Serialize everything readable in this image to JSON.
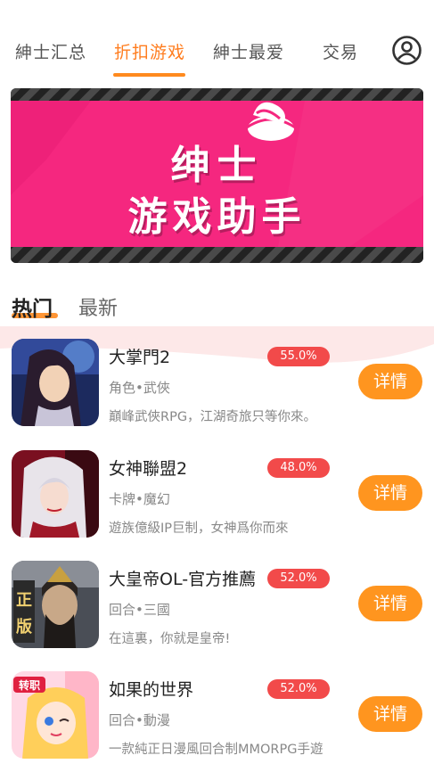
{
  "nav": {
    "tabs": [
      "紳士汇总",
      "折扣游戏",
      "紳士最爱",
      "交易"
    ],
    "active_index": 1
  },
  "banner": {
    "line1": "绅士",
    "line2": "游戏助手"
  },
  "sections": {
    "hot": "热门",
    "new": "最新"
  },
  "games": [
    {
      "name": "大掌門2",
      "discount": "55.0%",
      "category": "角色•武俠",
      "desc": "巔峰武俠RPG，江湖奇旅只等你來。",
      "button": "详情"
    },
    {
      "name": "女神聯盟2",
      "discount": "48.0%",
      "category": "卡牌•魔幻",
      "desc": "遊族億級IP巨制，女神爲你而來",
      "button": "详情"
    },
    {
      "name": "大皇帝OL-官方推薦",
      "discount": "52.0%",
      "category": "回合•三國",
      "desc": "在這裏，你就是皇帝!",
      "button": "详情"
    },
    {
      "name": "如果的世界",
      "discount": "52.0%",
      "category": "回合•動漫",
      "desc": "一款純正日漫風回合制MMORPG手遊",
      "button": "详情"
    }
  ],
  "colors": {
    "accent": "#ff8a1e",
    "discount": "#f24a4a",
    "banner_pink": "#f5277f"
  }
}
